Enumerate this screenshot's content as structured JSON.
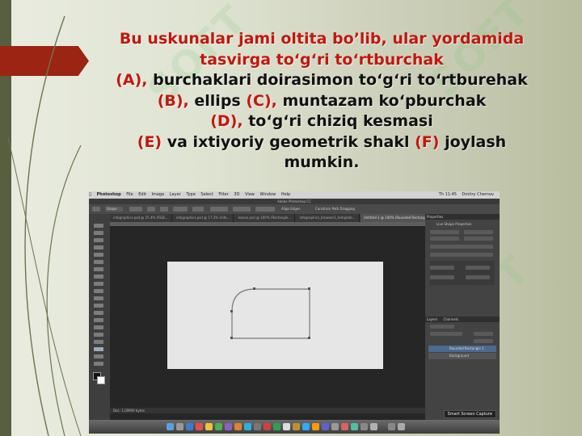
{
  "slide": {
    "line1": "Bu uskunalar jami oltita bo’lib, ular yordamida",
    "line2": "tasvirga to‘g‘ri to‘rtburchak",
    "line3_label": "(A),",
    "line3_text": " burchaklari doirasimon to‘g‘ri to‘rtburehak",
    "line4_label_b": "(B),",
    "line4_text_b": " ellips ",
    "line4_label_c": "(C),",
    "line4_text_c": " muntazam ko‘pburchak",
    "line5_label": "(D),",
    "line5_text": " to‘g‘ri chiziq kesmasi",
    "line6_label_e": "(E)",
    "line6_text": " va ixtiyoriy geometrik shakl ",
    "line6_label_f": "(F)",
    "line6_text_end": " joylash",
    "line7": "mumkin.",
    "watermark": "SOFT"
  },
  "colors": {
    "red": "#c0180f",
    "ribbon": "#9b2413",
    "left_bar": "#575f3e"
  },
  "screenshot": {
    "menu": [
      "Photoshop",
      "File",
      "Edit",
      "Image",
      "Layer",
      "Type",
      "Select",
      "Filter",
      "3D",
      "View",
      "Window",
      "Help"
    ],
    "clock": "Th 11:45",
    "user": "Dmitry Chernov",
    "app_title": "Adobe Photoshop CC",
    "tabs": [
      "infographics.psd @ 25.4% (RGB...",
      "infographics.psd @ 17.3% (info...",
      "lesson.psd @ 100% (Rectangle...",
      "infographics_browser1_template...",
      "Untitled-1 @ 100% (Rounded Rectangle 1, RGB/8)"
    ],
    "options": {
      "mode": "Shape",
      "align_edges": "Align Edges",
      "constrain": "Constrain Path Dragging"
    },
    "panels": {
      "properties": "Properties",
      "live_shape": "Live Shape Properties",
      "layers": "Layers",
      "channels": "Channels",
      "layer_items": [
        "Rounded Rectangle 1",
        "Background"
      ]
    },
    "status": "Doc: 1,00M/0 bytes",
    "capture_label": "Smart Screen Capture"
  }
}
